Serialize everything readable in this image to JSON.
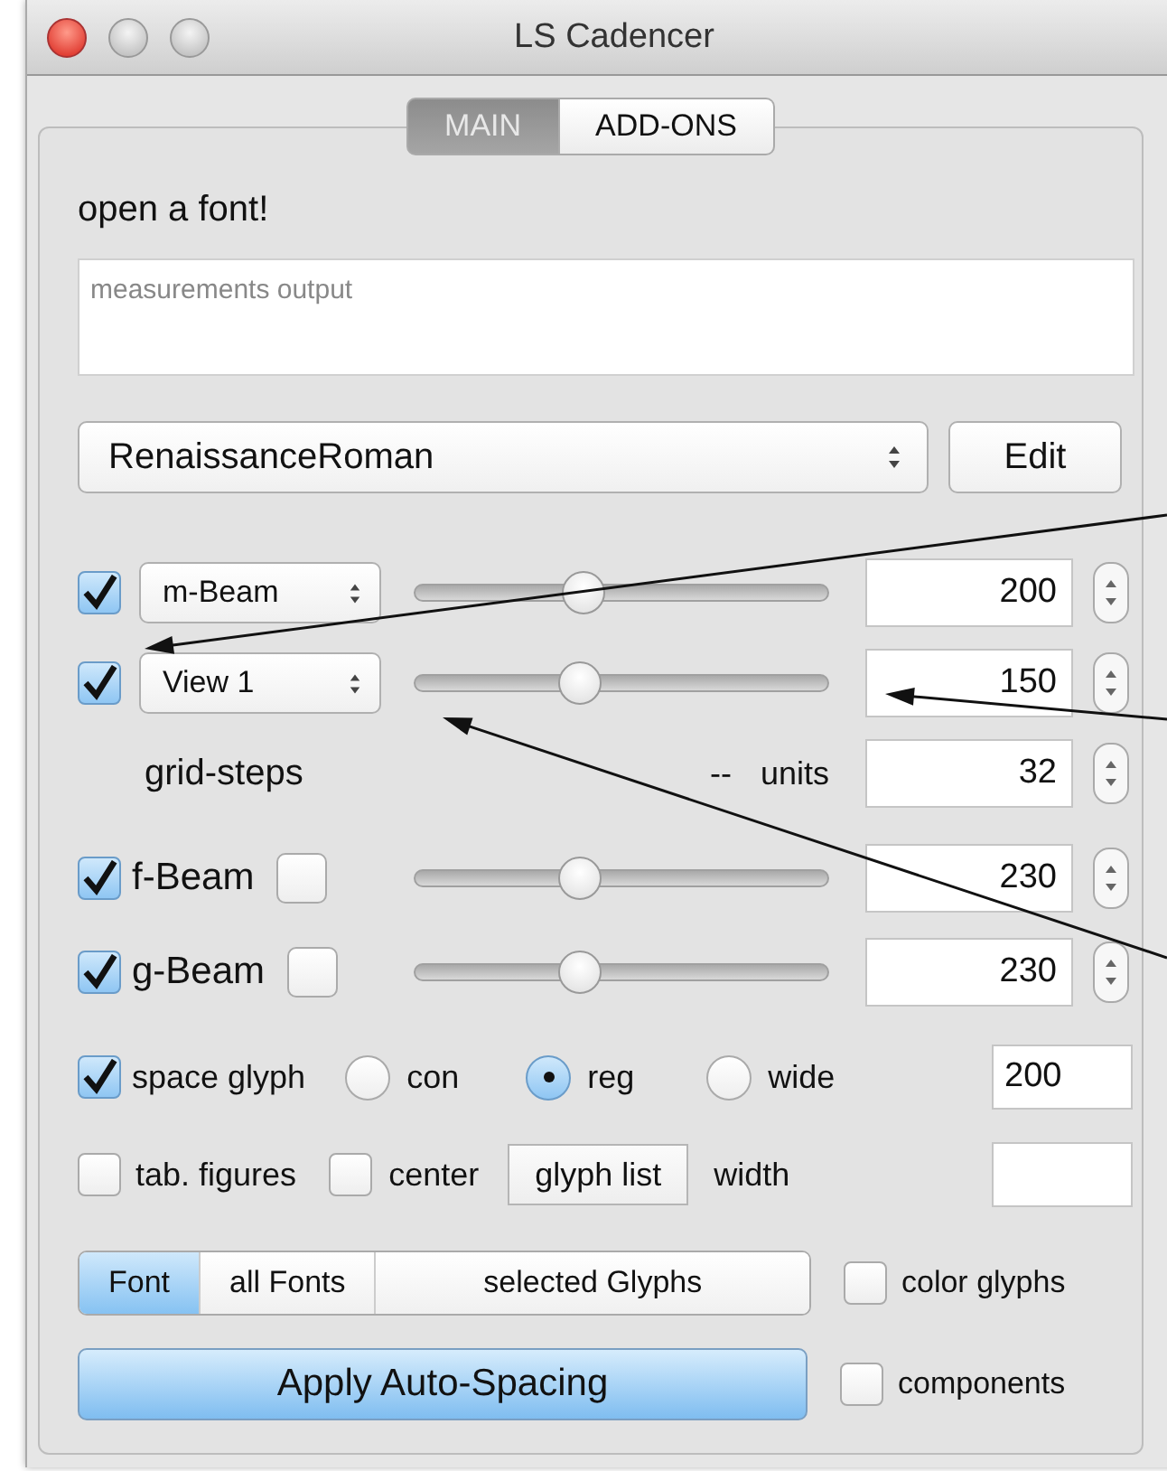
{
  "window": {
    "title": "LS Cadencer"
  },
  "tabs": [
    {
      "label": "MAIN",
      "selected": true
    },
    {
      "label": "ADD-ONS",
      "selected": false
    }
  ],
  "status": "open a font!",
  "output": {
    "placeholder": "measurements output"
  },
  "font_popup": {
    "value": "RenaissanceRoman"
  },
  "edit_button": "Edit",
  "beam_rows": [
    {
      "kind": "popup",
      "checked": true,
      "label": "m-Beam",
      "level": 0.41,
      "value": "200"
    },
    {
      "kind": "popup",
      "checked": true,
      "label": "View 1",
      "level": 0.4,
      "value": "150"
    },
    {
      "kind": "text",
      "label": "grid-steps",
      "reading": "--",
      "unit": "units",
      "value": "32"
    },
    {
      "kind": "check",
      "checked": true,
      "label": "f-Beam",
      "option_checked": false,
      "level": 0.4,
      "value": "230"
    },
    {
      "kind": "check",
      "checked": true,
      "label": "g-Beam",
      "option_checked": false,
      "level": 0.4,
      "value": "230"
    }
  ],
  "space_glyph": {
    "checked": true,
    "label": "space glyph",
    "options": [
      {
        "label": "con",
        "selected": false
      },
      {
        "label": "reg",
        "selected": true
      },
      {
        "label": "wide",
        "selected": false
      }
    ],
    "value": "200"
  },
  "tab_figures": {
    "checked": false,
    "label": "tab. figures"
  },
  "center": {
    "checked": false,
    "label": "center"
  },
  "glyph_list_button": "glyph list",
  "width_label": "width",
  "scope": [
    {
      "label": "Font",
      "selected": true
    },
    {
      "label": "all Fonts",
      "selected": false
    },
    {
      "label": "selected Glyphs",
      "selected": false
    }
  ],
  "color_glyphs": {
    "checked": false,
    "label": "color glyphs"
  },
  "components": {
    "checked": false,
    "label": "components"
  },
  "apply_button": "Apply Auto-Spacing"
}
